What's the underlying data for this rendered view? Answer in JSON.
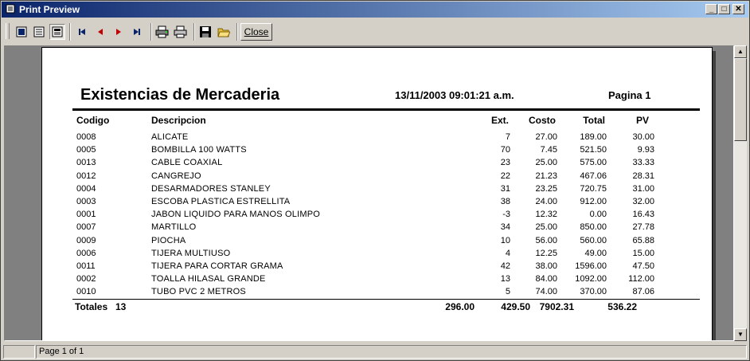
{
  "window": {
    "title": "Print Preview"
  },
  "toolbar": {
    "buttons": [
      {
        "name": "whole-page-icon"
      },
      {
        "name": "page-width-icon"
      },
      {
        "name": "zoom-100-icon"
      },
      {
        "name": "first-page-icon"
      },
      {
        "name": "prev-page-icon"
      },
      {
        "name": "next-page-icon"
      },
      {
        "name": "last-page-icon"
      },
      {
        "name": "print-setup-icon"
      },
      {
        "name": "print-icon"
      },
      {
        "name": "save-icon"
      },
      {
        "name": "open-icon"
      }
    ],
    "close_label": "Close"
  },
  "report": {
    "title": "Existencias de Mercaderia",
    "datetime": "13/11/2003 09:01:21 a.m.",
    "page_label": "Pagina 1",
    "columns": {
      "codigo": "Codigo",
      "descripcion": "Descripcion",
      "ext": "Ext.",
      "costo": "Costo",
      "total": "Total",
      "pv": "PV"
    },
    "rows": [
      {
        "codigo": "0008",
        "descripcion": "ALICATE",
        "ext": "7",
        "costo": "27.00",
        "total": "189.00",
        "pv": "30.00"
      },
      {
        "codigo": "0005",
        "descripcion": "BOMBILLA 100 WATTS",
        "ext": "70",
        "costo": "7.45",
        "total": "521.50",
        "pv": "9.93"
      },
      {
        "codigo": "0013",
        "descripcion": "CABLE COAXIAL",
        "ext": "23",
        "costo": "25.00",
        "total": "575.00",
        "pv": "33.33"
      },
      {
        "codigo": "0012",
        "descripcion": "CANGREJO",
        "ext": "22",
        "costo": "21.23",
        "total": "467.06",
        "pv": "28.31"
      },
      {
        "codigo": "0004",
        "descripcion": "DESARMADORES STANLEY",
        "ext": "31",
        "costo": "23.25",
        "total": "720.75",
        "pv": "31.00"
      },
      {
        "codigo": "0003",
        "descripcion": "ESCOBA PLASTICA ESTRELLITA",
        "ext": "38",
        "costo": "24.00",
        "total": "912.00",
        "pv": "32.00"
      },
      {
        "codigo": "0001",
        "descripcion": "JABON LIQUIDO PARA MANOS OLIMPO",
        "ext": "-3",
        "costo": "12.32",
        "total": "0.00",
        "pv": "16.43"
      },
      {
        "codigo": "0007",
        "descripcion": "MARTILLO",
        "ext": "34",
        "costo": "25.00",
        "total": "850.00",
        "pv": "27.78"
      },
      {
        "codigo": "0009",
        "descripcion": "PIOCHA",
        "ext": "10",
        "costo": "56.00",
        "total": "560.00",
        "pv": "65.88"
      },
      {
        "codigo": "0006",
        "descripcion": "TIJERA MULTIUSO",
        "ext": "4",
        "costo": "12.25",
        "total": "49.00",
        "pv": "15.00"
      },
      {
        "codigo": "0011",
        "descripcion": "TIJERA PARA CORTAR GRAMA",
        "ext": "42",
        "costo": "38.00",
        "total": "1596.00",
        "pv": "47.50"
      },
      {
        "codigo": "0002",
        "descripcion": "TOALLA HILASAL GRANDE",
        "ext": "13",
        "costo": "84.00",
        "total": "1092.00",
        "pv": "112.00"
      },
      {
        "codigo": "0010",
        "descripcion": "TUBO PVC 2 METROS",
        "ext": "5",
        "costo": "74.00",
        "total": "370.00",
        "pv": "87.06"
      }
    ],
    "totals": {
      "label": "Totales",
      "count": "13",
      "ext": "296.00",
      "costo": "429.50",
      "total": "7902.31",
      "pv": "536.22"
    }
  },
  "status": {
    "page_info": "Page 1 of 1"
  }
}
